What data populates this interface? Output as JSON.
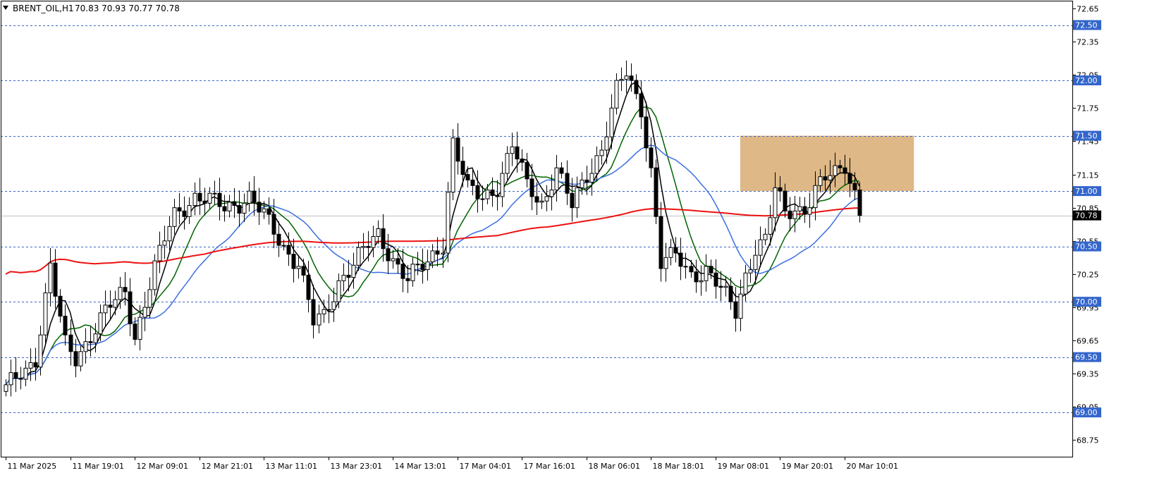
{
  "header": {
    "symbol": "BRENT_OIL,H1",
    "ohlc": "70.83 70.93 70.77 70.78"
  },
  "colors": {
    "background": "#ffffff",
    "level_line": "#3a66c4",
    "level_tag": "#3366cc",
    "price_line": "#c0c0c0",
    "price_tag": "#000000",
    "zone": "#deb887",
    "ma_black": "#000000",
    "ma_green": "#006400",
    "ma_blue": "#3b6fe0",
    "ma_red": "#ee1111",
    "bull_body": "#ffffff",
    "bear_body": "#000000"
  },
  "chart_data": {
    "type": "candlestick",
    "symbol": "BRENT_OIL",
    "timeframe": "H1",
    "ylim": [
      68.6,
      72.72
    ],
    "y_ticks": [
      "72.65",
      "72.35",
      "72.05",
      "71.75",
      "71.45",
      "71.15",
      "70.85",
      "70.55",
      "70.25",
      "69.95",
      "69.65",
      "69.35",
      "69.05",
      "68.75"
    ],
    "x_ticks": [
      "11 Mar 2025",
      "11 Mar 19:01",
      "12 Mar 09:01",
      "12 Mar 21:01",
      "13 Mar 11:01",
      "13 Mar 23:01",
      "14 Mar 13:01",
      "17 Mar 04:01",
      "17 Mar 16:01",
      "18 Mar 06:01",
      "18 Mar 18:01",
      "19 Mar 08:01",
      "19 Mar 20:01",
      "20 Mar 10:01"
    ],
    "x_tick_bars": [
      0,
      13,
      26,
      39,
      52,
      65,
      78,
      91,
      104,
      117,
      130,
      143,
      156,
      169
    ],
    "horizontal_levels": [
      {
        "value": 72.5,
        "label": "72.50"
      },
      {
        "value": 72.0,
        "label": "72.00"
      },
      {
        "value": 71.5,
        "label": "71.50"
      },
      {
        "value": 71.0,
        "label": "71.00"
      },
      {
        "value": 70.5,
        "label": "70.50"
      },
      {
        "value": 70.0,
        "label": "70.00"
      },
      {
        "value": 69.5,
        "label": "69.50"
      },
      {
        "value": 69.0,
        "label": "69.00"
      }
    ],
    "current_price": {
      "value": 70.78,
      "label": "70.78"
    },
    "zone": {
      "start_bar": 148,
      "end_bar": 183,
      "low": 71.0,
      "high": 71.5
    },
    "anchors": [
      [
        0,
        69.2
      ],
      [
        6,
        69.5
      ],
      [
        9,
        70.3
      ],
      [
        12,
        69.6
      ],
      [
        14,
        69.5
      ],
      [
        20,
        69.9
      ],
      [
        24,
        70.1
      ],
      [
        26,
        69.7
      ],
      [
        30,
        70.3
      ],
      [
        34,
        70.8
      ],
      [
        38,
        70.95
      ],
      [
        44,
        70.85
      ],
      [
        49,
        70.95
      ],
      [
        53,
        70.7
      ],
      [
        56,
        70.5
      ],
      [
        59,
        70.35
      ],
      [
        62,
        69.8
      ],
      [
        64,
        69.85
      ],
      [
        67,
        70.2
      ],
      [
        72,
        70.45
      ],
      [
        75,
        70.6
      ],
      [
        78,
        70.4
      ],
      [
        81,
        70.2
      ],
      [
        85,
        70.35
      ],
      [
        88,
        70.55
      ],
      [
        90,
        71.45
      ],
      [
        93,
        71.0
      ],
      [
        96,
        70.95
      ],
      [
        99,
        71.05
      ],
      [
        102,
        71.4
      ],
      [
        105,
        71.05
      ],
      [
        108,
        70.9
      ],
      [
        111,
        71.2
      ],
      [
        114,
        70.85
      ],
      [
        117,
        71.15
      ],
      [
        120,
        71.4
      ],
      [
        123,
        71.9
      ],
      [
        125,
        72.05
      ],
      [
        128,
        71.75
      ],
      [
        130,
        71.2
      ],
      [
        132,
        70.35
      ],
      [
        135,
        70.4
      ],
      [
        138,
        70.25
      ],
      [
        141,
        70.3
      ],
      [
        144,
        70.1
      ],
      [
        147,
        69.9
      ],
      [
        149,
        70.25
      ],
      [
        151,
        70.5
      ],
      [
        153,
        70.55
      ],
      [
        155,
        71.0
      ],
      [
        157,
        70.8
      ],
      [
        159,
        70.85
      ],
      [
        161,
        70.85
      ],
      [
        163,
        71.0
      ],
      [
        165,
        71.1
      ],
      [
        167,
        71.15
      ],
      [
        169,
        71.25
      ],
      [
        171,
        71.0
      ],
      [
        172,
        70.78
      ]
    ],
    "ma_lines": [
      {
        "color": "#000000",
        "period": 5
      },
      {
        "color": "#006400",
        "period": 10
      },
      {
        "color": "#3b6fe0",
        "period": 21
      },
      {
        "color": "#ee1111",
        "period": 100
      }
    ]
  }
}
